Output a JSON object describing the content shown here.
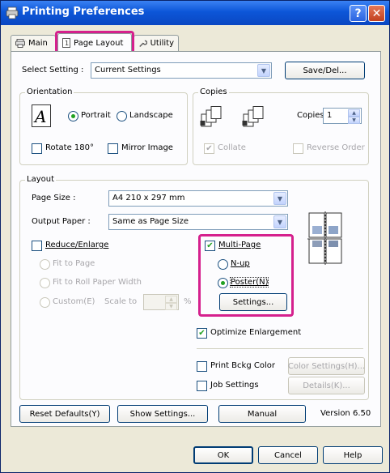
{
  "window": {
    "title": "Printing Preferences",
    "help_glyph": "?",
    "close_glyph": "✕"
  },
  "tabs": [
    {
      "label": "Main",
      "icon": "printer-icon"
    },
    {
      "label": "Page Layout",
      "icon": "page-icon"
    },
    {
      "label": "Utility",
      "icon": "wrench-icon"
    }
  ],
  "select_setting": {
    "label": "Select Setting :",
    "value": "Current Settings",
    "save_button": "Save/Del..."
  },
  "orientation": {
    "title": "Orientation",
    "portrait": "Portrait",
    "landscape": "Landscape",
    "rotate": "Rotate 180°",
    "mirror": "Mirror Image",
    "selected": "Portrait",
    "page_letter": "A"
  },
  "copies": {
    "title": "Copies",
    "label": "Copies",
    "value": "1",
    "collate": "Collate",
    "reverse": "Reverse Order",
    "icon_collate_text": "¹²³",
    "icon_reverse_text": "¹²³"
  },
  "layout": {
    "title": "Layout",
    "page_size_label": "Page Size :",
    "page_size_value": "A4 210 x 297 mm",
    "output_paper_label": "Output Paper :",
    "output_paper_value": "Same as Page Size",
    "reduce_enlarge": "Reduce/Enlarge",
    "fit_to_page": "Fit to Page",
    "fit_roll": "Fit to Roll Paper Width",
    "custom": "Custom(E)",
    "scale_to": "Scale to",
    "percent": "%",
    "multi_page": "Multi-Page",
    "nup": "N-up",
    "poster": "Poster(N)",
    "settings_button": "Settings...",
    "optimize": "Optimize Enlargement",
    "print_bckg": "Print Bckg Color",
    "color_settings": "Color Settings(H)...",
    "job_settings": "Job Settings",
    "details": "Details(K)..."
  },
  "bottom": {
    "reset": "Reset Defaults(Y)",
    "show_settings": "Show Settings...",
    "manual": "Manual",
    "version": "Version 6.50"
  },
  "dialog": {
    "ok": "OK",
    "cancel": "Cancel",
    "help": "Help"
  },
  "colors": {
    "accent_highlight": "#D5208D",
    "check_green": "#21A121",
    "title_blue": "#0C56D8"
  }
}
